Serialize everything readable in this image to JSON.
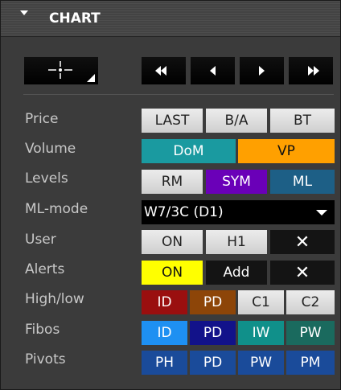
{
  "header": {
    "title": "CHART"
  },
  "rows": [
    {
      "label": "Price",
      "buttons": [
        "LAST",
        "B/A",
        "BT"
      ]
    },
    {
      "label": "Volume",
      "buttons": [
        "DoM",
        "VP"
      ]
    },
    {
      "label": "Levels",
      "buttons": [
        "RM",
        "SYM",
        "ML"
      ]
    },
    {
      "label": "ML-mode",
      "select": "W7/3C (D1)"
    },
    {
      "label": "User",
      "buttons": [
        "ON",
        "H1",
        "✕"
      ]
    },
    {
      "label": "Alerts",
      "buttons": [
        "ON",
        "Add",
        "✕"
      ]
    },
    {
      "label": "High/low",
      "buttons": [
        "ID",
        "PD",
        "C1",
        "C2"
      ]
    },
    {
      "label": "Fibos",
      "buttons": [
        "ID",
        "PD",
        "IW",
        "PW"
      ]
    },
    {
      "label": "Pivots",
      "buttons": [
        "PH",
        "PD",
        "PW",
        "PM"
      ]
    }
  ],
  "colors": {
    "teal": "#1a9aa0",
    "orange": "#ffa000",
    "purple": "#6a00b8",
    "steel_blue": "#1d5f86",
    "yellow": "#ffff00",
    "dark_red": "#9a0f0f",
    "brown": "#8d4508",
    "blue": "#1e90f2",
    "navy": "#12128a",
    "dark_teal": "#10908a",
    "green_teal": "#1a6a5e",
    "pivot_blue": "#1a4b9a"
  }
}
